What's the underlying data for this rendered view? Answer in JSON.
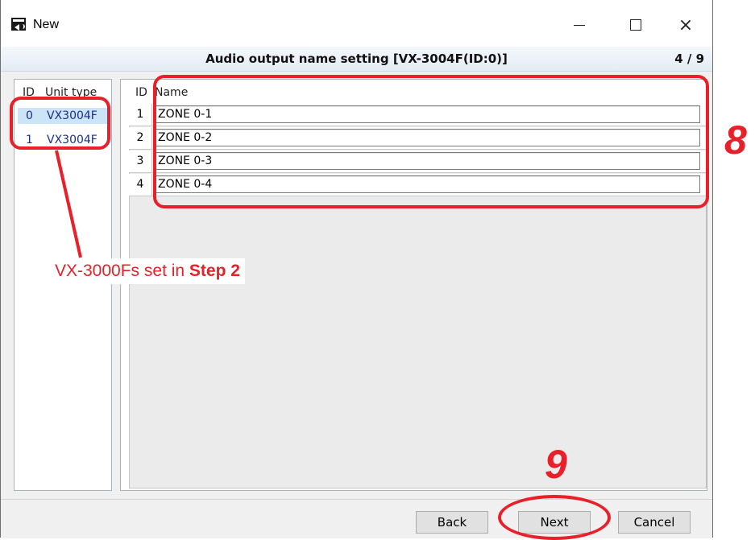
{
  "window": {
    "title": "New",
    "controls": {
      "minimize": "minimize",
      "maximize": "maximize",
      "close": "×"
    }
  },
  "header": {
    "title": "Audio output name setting [VX-3004F(ID:0)]",
    "page": "4 / 9"
  },
  "units_table": {
    "columns": [
      "ID",
      "Unit type"
    ],
    "rows": [
      {
        "id": "0",
        "type": "VX3004F",
        "selected": true
      },
      {
        "id": "1",
        "type": "VX3004F",
        "selected": false
      }
    ]
  },
  "names_table": {
    "columns": [
      "ID",
      "Name"
    ],
    "rows": [
      {
        "id": "1",
        "name": "ZONE 0-1"
      },
      {
        "id": "2",
        "name": "ZONE 0-2"
      },
      {
        "id": "3",
        "name": "ZONE 0-3"
      },
      {
        "id": "4",
        "name": "ZONE 0-4"
      }
    ]
  },
  "footer": {
    "back": "Back",
    "next": "Next",
    "cancel": "Cancel"
  },
  "annotations": {
    "callout_prefix": "VX-3000Fs set in ",
    "callout_bold": "Step 2",
    "step_8": "8",
    "step_9": "9",
    "color": "#e8202a"
  },
  "colors": {
    "selected_row": "#cce4f7",
    "unit_text": "#1a2f8a",
    "header_bg": "#e3ecf4"
  }
}
